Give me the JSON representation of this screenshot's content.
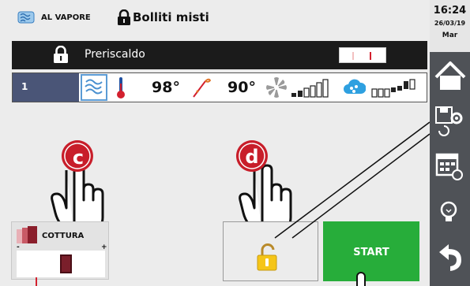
{
  "header": {
    "mode": "AL VAPORE",
    "program": "Bolliti misti"
  },
  "preheat": {
    "label": "Preriscaldo"
  },
  "status": {
    "step": "1",
    "temperature": "98°",
    "core_temperature": "90°",
    "fan_level": 2,
    "humidity_level": 3
  },
  "callouts": {
    "c": "c",
    "d": "d"
  },
  "cottura": {
    "label": "COTTURA",
    "minus": "-",
    "plus": "+"
  },
  "start": {
    "label": "START"
  },
  "sidebar": {
    "time": "16:24",
    "date": "26/03/19",
    "day": "Mar"
  },
  "colors": {
    "start_green": "#27ad3a",
    "callout_red": "#d3202e",
    "step_blue": "#4a5577",
    "sidebar_dark": "#4f5257"
  },
  "icons": [
    "steam-icon",
    "lock-icon",
    "thermometer-icon",
    "core-probe-icon",
    "fan-icon",
    "humidity-icon",
    "home-icon",
    "save-settings-icon",
    "calendar-icon",
    "lightbulb-icon",
    "back-icon",
    "padlock-open-icon",
    "pointing-hand-icon"
  ]
}
